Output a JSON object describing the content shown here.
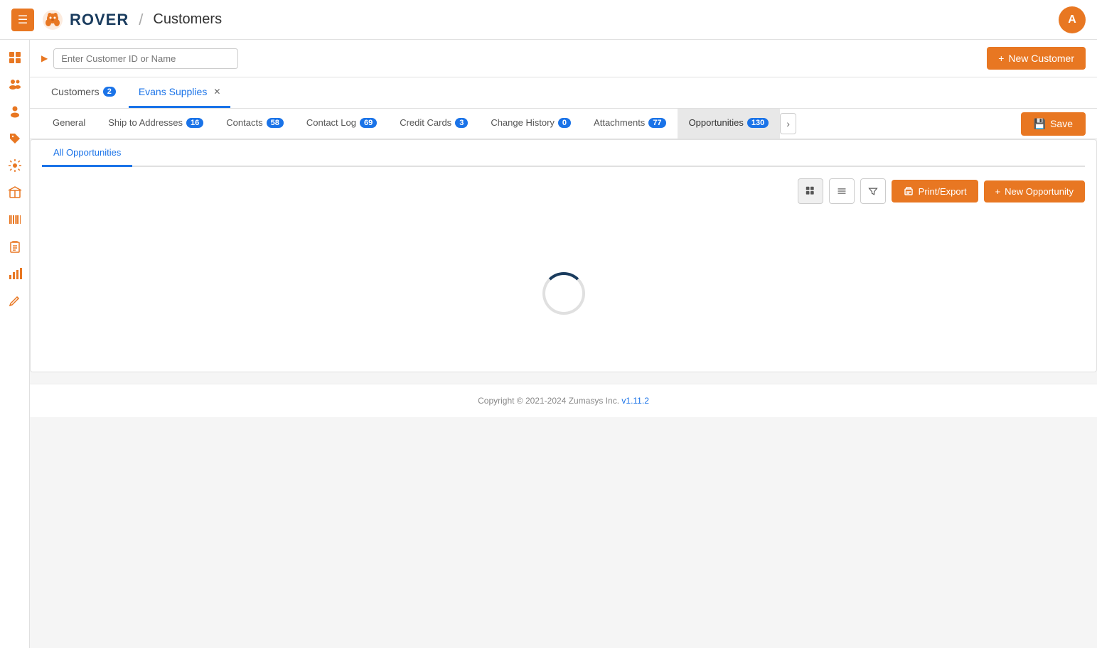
{
  "header": {
    "title": "ROVER",
    "breadcrumb_sep": "/",
    "page": "Customers",
    "user_initial": "A"
  },
  "search": {
    "placeholder": "Enter Customer ID or Name"
  },
  "new_customer_btn": {
    "label": "New Customer",
    "icon": "+"
  },
  "customer_tabs": [
    {
      "label": "Customers",
      "badge": "2",
      "active": false
    },
    {
      "label": "Evans Supplies",
      "badge": null,
      "active": true,
      "closable": true
    }
  ],
  "inner_tabs": [
    {
      "label": "General",
      "badge": null
    },
    {
      "label": "Ship to Addresses",
      "badge": "16"
    },
    {
      "label": "Contacts",
      "badge": "58"
    },
    {
      "label": "Contact Log",
      "badge": "69"
    },
    {
      "label": "Credit Cards",
      "badge": "3"
    },
    {
      "label": "Change History",
      "badge": "0"
    },
    {
      "label": "Attachments",
      "badge": "77"
    },
    {
      "label": "Opportunities",
      "badge": "130",
      "highlighted": true
    }
  ],
  "save_btn": {
    "label": "Save"
  },
  "sub_tabs": [
    {
      "label": "All Opportunities",
      "active": true
    }
  ],
  "toolbar": {
    "grid_icon": "⊞",
    "list_icon": "≡",
    "filter_icon": "⊿",
    "print_export_label": "Print/Export",
    "new_opportunity_label": "New Opportunity"
  },
  "footer": {
    "text": "Copyright © 2021-2024 Zumasys Inc.",
    "version": "v1.11.2",
    "version_link": "#"
  },
  "sidebar_icons": [
    {
      "name": "grid-icon",
      "symbol": "⊞"
    },
    {
      "name": "people-group-icon",
      "symbol": "👥"
    },
    {
      "name": "person-icon",
      "symbol": "👤"
    },
    {
      "name": "tag-icon",
      "symbol": "🏷"
    },
    {
      "name": "gear-icon",
      "symbol": "⚙"
    },
    {
      "name": "box-icon",
      "symbol": "📦"
    },
    {
      "name": "barcode-icon",
      "symbol": "▦"
    },
    {
      "name": "clipboard-icon",
      "symbol": "📋"
    },
    {
      "name": "chart-icon",
      "symbol": "📊"
    },
    {
      "name": "pencil-icon",
      "symbol": "✏"
    }
  ]
}
